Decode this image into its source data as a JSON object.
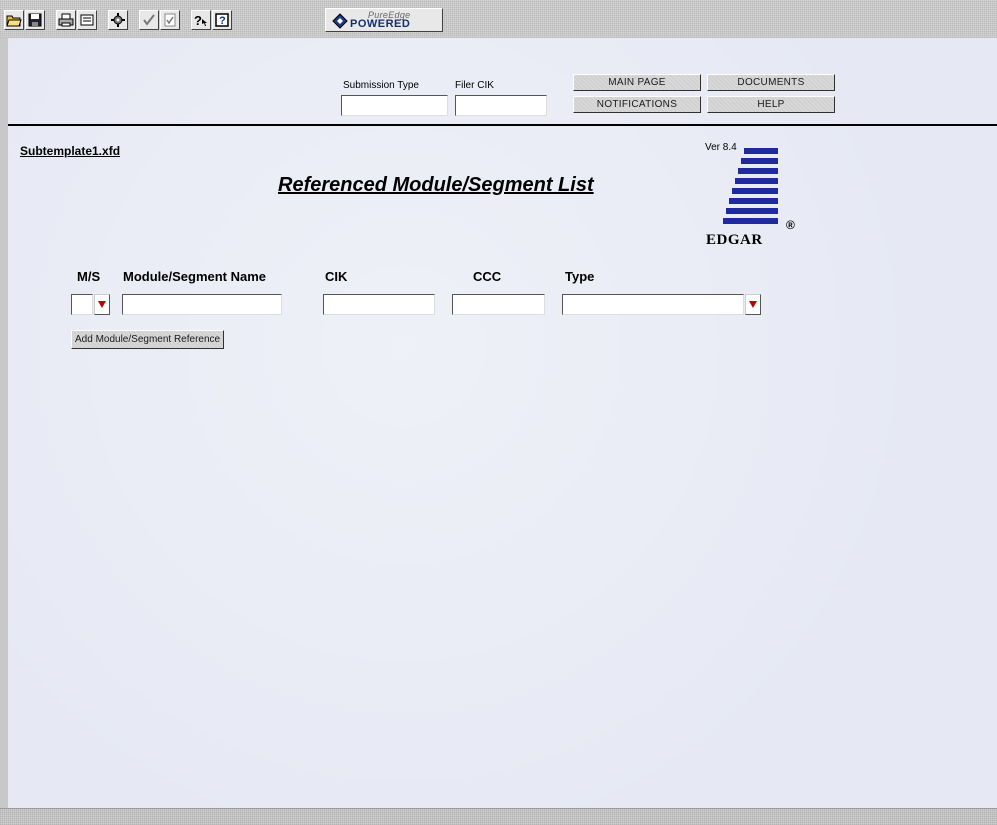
{
  "toolbar": {
    "buttons": [
      {
        "name": "open-icon"
      },
      {
        "name": "save-icon"
      },
      {
        "name": "print-icon"
      },
      {
        "name": "form-view-icon"
      },
      {
        "name": "settings-icon"
      },
      {
        "name": "validate-icon"
      },
      {
        "name": "checklist-icon"
      },
      {
        "name": "whats-this-icon"
      },
      {
        "name": "help-icon"
      }
    ],
    "badge": {
      "brand": "PureEdge",
      "powered": "POWERED"
    }
  },
  "header": {
    "submission_type_label": "Submission Type",
    "filer_cik_label": "Filer CIK",
    "submission_type_value": "",
    "filer_cik_value": "",
    "buttons": {
      "main_page": "MAIN PAGE",
      "documents": "DOCUMENTS",
      "notifications": "NOTIFICATIONS",
      "help": "HELP"
    }
  },
  "form": {
    "filename": "Subtemplate1.xfd",
    "title": "Referenced Module/Segment List",
    "version": "Ver 8.4",
    "logo_text": "EDGAR",
    "logo_reg": "®",
    "columns": {
      "ms": "M/S",
      "name": "Module/Segment Name",
      "cik": "CIK",
      "ccc": "CCC",
      "type": "Type"
    },
    "values": {
      "ms": "",
      "name": "",
      "cik": "",
      "ccc": "",
      "type": ""
    },
    "add_button": "Add Module/Segment Reference"
  },
  "colors": {
    "page_bg": "#e6e9f4",
    "logo_blue": "#1f2a9e",
    "dropdown_arrow": "#c00000"
  }
}
